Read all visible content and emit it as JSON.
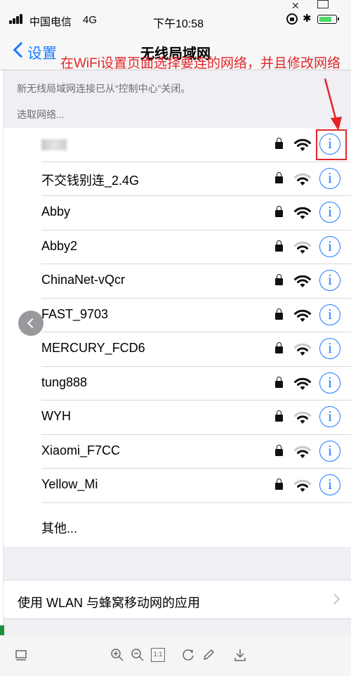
{
  "status_bar": {
    "carrier": "中国电信",
    "network_type": "4G",
    "time": "下午10:58",
    "battery_color": "#4cd964"
  },
  "nav": {
    "back_label": "设置",
    "title": "无线局域网"
  },
  "annotation": {
    "text": "在WiFi设置页面选择要连的网络，并且修改网络",
    "color": "#e3252a"
  },
  "note": "新无线局域网连接已从“控制中心”关闭。",
  "section_label": "选取网络...",
  "networks": [
    {
      "name": "",
      "secured": true,
      "signal": 3
    },
    {
      "name": "不交钱别连_2.4G",
      "secured": true,
      "signal": 2
    },
    {
      "name": "Abby",
      "secured": true,
      "signal": 3
    },
    {
      "name": "Abby2",
      "secured": true,
      "signal": 2
    },
    {
      "name": "ChinaNet-vQcr",
      "secured": true,
      "signal": 3
    },
    {
      "name": "FAST_9703",
      "secured": true,
      "signal": 3
    },
    {
      "name": "MERCURY_FCD6",
      "secured": true,
      "signal": 2
    },
    {
      "name": "tung888",
      "secured": true,
      "signal": 3
    },
    {
      "name": "WYH",
      "secured": true,
      "signal": 2
    },
    {
      "name": "Xiaomi_F7CC",
      "secured": true,
      "signal": 2
    },
    {
      "name": "Yellow_Mi",
      "secured": true,
      "signal": 2
    }
  ],
  "other_label": "其他...",
  "info_glyph": "i",
  "apps_label": "使用 WLAN 与蜂窝移动网的应用",
  "toolbar": {
    "icons": [
      "panel-icon",
      "zoom-in-icon",
      "zoom-out-icon",
      "actual-size-icon",
      "rotate-icon",
      "edit-icon",
      "download-icon"
    ],
    "actual_size_label": "1:1"
  },
  "colors": {
    "accent": "#1a7aff",
    "annotation": "#e3252a",
    "background": "#efeff4"
  }
}
